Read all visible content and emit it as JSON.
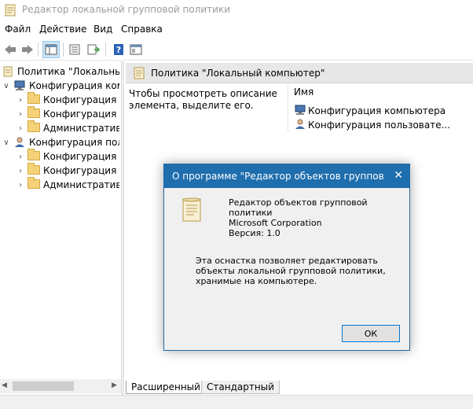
{
  "window": {
    "title": "Редактор локальной групповой политики"
  },
  "menu": [
    "Файл",
    "Действие",
    "Вид",
    "Справка"
  ],
  "tree": {
    "root": "Политика \"Локальный компьютер\"",
    "computer": "Конфигурация компьютера",
    "computer_children": [
      "Конфигурация программ",
      "Конфигурация Windows",
      "Административные шаблоны"
    ],
    "user": "Конфигурация пользователя",
    "user_children": [
      "Конфигурация программ",
      "Конфигурация Windows",
      "Административные шаблоны"
    ]
  },
  "right": {
    "header": "Политика \"Локальный компьютер\"",
    "description": "Чтобы просмотреть описание элемента, выделите его.",
    "column": "Имя",
    "items": [
      "Конфигурация компьютера",
      "Конфигурация пользовате..."
    ]
  },
  "tabs": [
    "Расширенный",
    "Стандартный"
  ],
  "dialog": {
    "title": "О программе \"Редактор объектов групповой п...",
    "name": "Редактор объектов групповой политики",
    "company": "Microsoft Corporation",
    "version": "Версия: 1.0",
    "note": "Эта оснастка позволяет редактировать объекты локальной групповой политики, хранимые на компьютере.",
    "ok": "ОК"
  },
  "colors": {
    "dialog_title": "#1f6eae",
    "ok_border": "#0078d7",
    "header_bg": "#e7e7e7"
  }
}
